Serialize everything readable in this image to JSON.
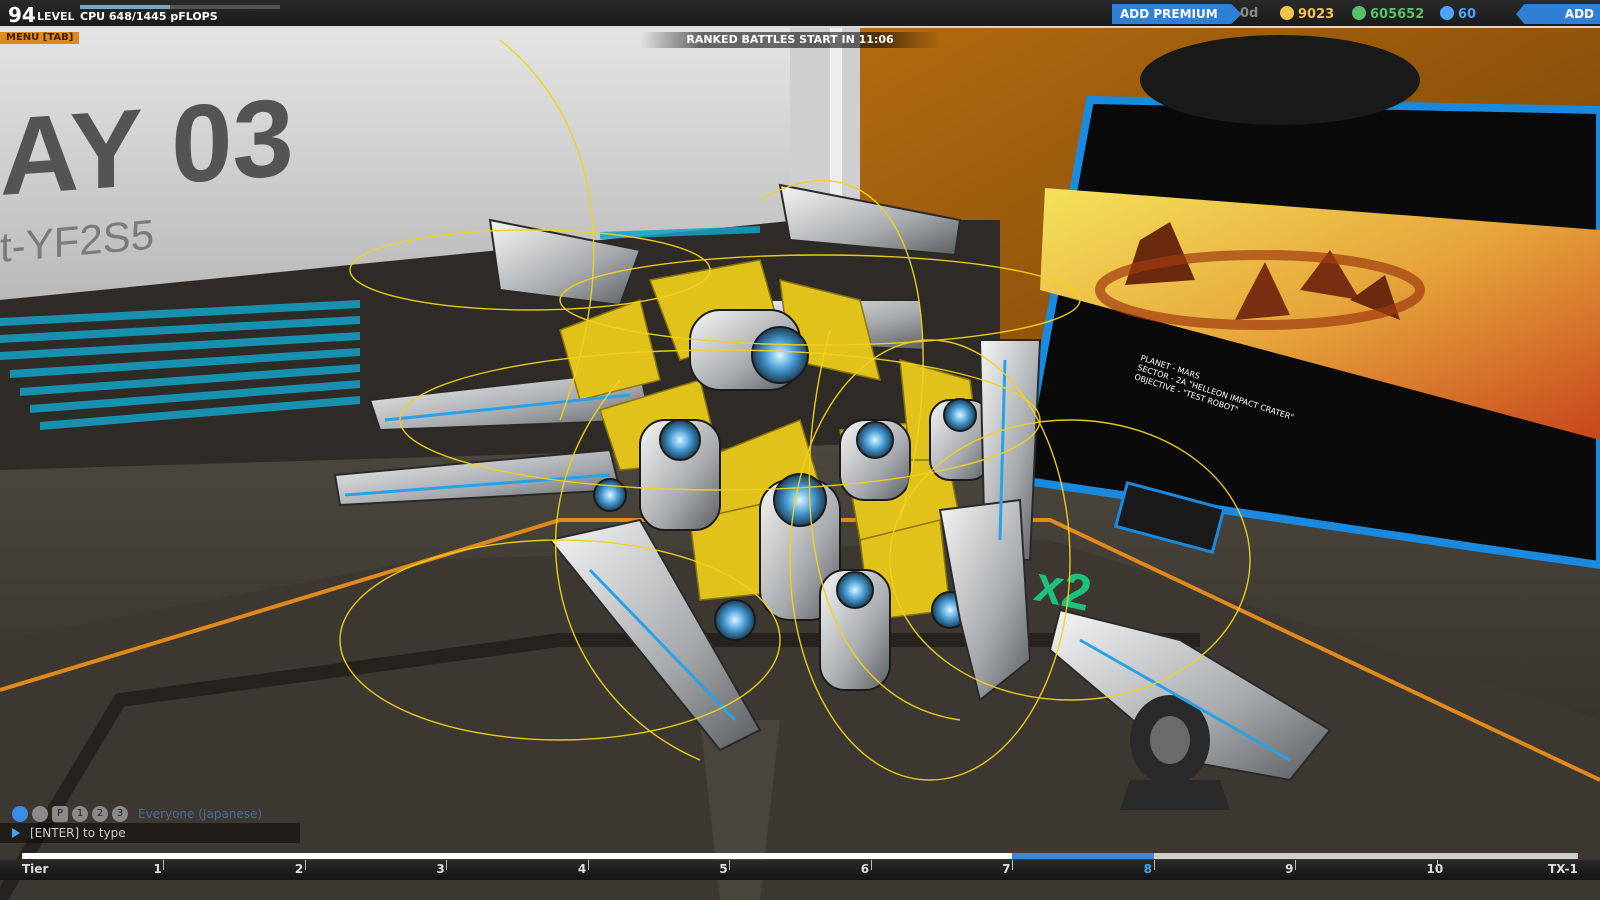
{
  "topbar": {
    "level_value": "94",
    "level_label": "LEVEL",
    "cpu_text": "CPU 648/1445 pFLOPS",
    "cpu_fraction": 0.448,
    "add_premium_label": "ADD PREMIUM",
    "premium_days": "0d",
    "currencies": [
      {
        "name": "robits",
        "value": "9023",
        "color": "#f2c44a",
        "icon": "star-coin-icon"
      },
      {
        "name": "rp",
        "value": "605652",
        "color": "#56c06a",
        "icon": "rp-icon"
      },
      {
        "name": "cc",
        "value": "60",
        "color": "#4da3ff",
        "icon": "cc-icon"
      }
    ],
    "add_funds_label": "ADD FUNDS"
  },
  "menu_label": "MENU [TAB]",
  "ranked_text": "RANKED BATTLES START IN 11:06",
  "bay": {
    "title": "AY 03",
    "subtitle": "t-YF2S5"
  },
  "monitor": {
    "line1": "PLANET - MARS",
    "line2": "SECTOR - 2A \"HELLEON IMPACT CRATER\"",
    "line3": "OBJECTIVE - \"TEST ROBOT\""
  },
  "floor_marking": "x2",
  "chat": {
    "channel": "Everyone (Japanese)",
    "input_placeholder": "[ENTER] to type",
    "icons": [
      "globe-icon",
      "clan-icon",
      "party-icon",
      "user-1-icon",
      "user-2-icon",
      "user-3-icon"
    ],
    "icon_labels": [
      "",
      "",
      "P",
      "1",
      "2",
      "3"
    ]
  },
  "tier_bar": {
    "labels": [
      "Tier",
      "1",
      "2",
      "3",
      "4",
      "5",
      "6",
      "7",
      "8",
      "9",
      "10",
      "TX-1"
    ],
    "current_tier": "8",
    "progress_fraction": 0.715
  },
  "colors": {
    "accent_blue": "#2f7fd4",
    "menu_orange": "#e08a1e",
    "selection_yellow": "#f2d21a"
  }
}
